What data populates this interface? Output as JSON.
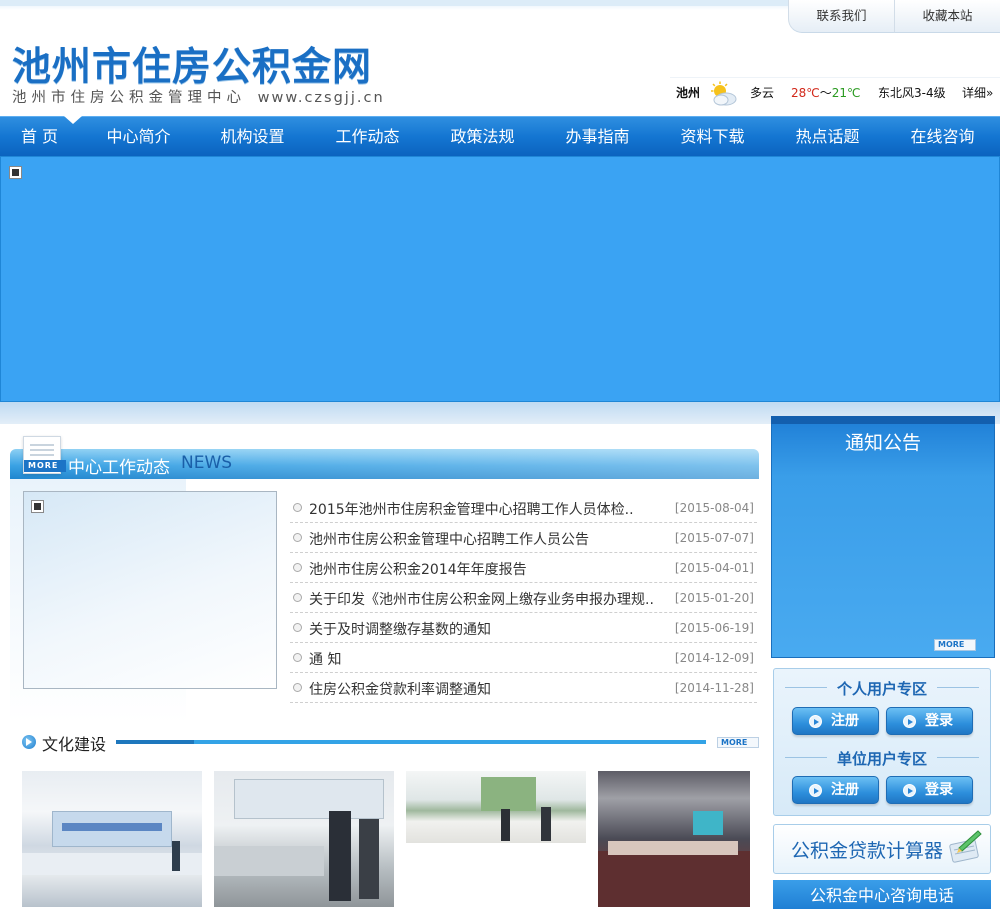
{
  "header": {
    "site_title": "池州市住房公积金网",
    "site_subtitle": "池州市住房公积金管理中心",
    "site_url": "www.czsgjj.cn",
    "top_links": {
      "contact": "联系我们",
      "favorite": "收藏本站"
    }
  },
  "weather": {
    "city": "池州",
    "condition": "多云",
    "temp_high": "28℃",
    "temp_sep": "～",
    "temp_low": "21℃",
    "wind": "东北风3-4级",
    "detail": "详细»",
    "icon": "partly-cloudy-icon"
  },
  "nav": {
    "items": [
      "首 页",
      "中心简介",
      "机构设置",
      "工作动态",
      "政策法规",
      "办事指南",
      "资料下载",
      "热点话题",
      "在线咨询"
    ]
  },
  "news": {
    "title": "中心工作动态",
    "title_en": "NEWS",
    "more": "MORE",
    "items": [
      {
        "title": "2015年池州市住房积金管理中心招聘工作人员体检..",
        "date": "[2015-08-04]"
      },
      {
        "title": "池州市住房公积金管理中心招聘工作人员公告",
        "date": "[2015-07-07]"
      },
      {
        "title": "池州市住房公积金2014年年度报告",
        "date": "[2015-04-01]"
      },
      {
        "title": "关于印发《池州市住房公积金网上缴存业务申报办理规..",
        "date": "[2015-01-20]"
      },
      {
        "title": "关于及时调整缴存基数的通知",
        "date": "[2015-06-19]"
      },
      {
        "title": "通  知",
        "date": "[2014-12-09]"
      },
      {
        "title": "住房公积金贷款利率调整通知",
        "date": "[2014-11-28]"
      }
    ]
  },
  "culture": {
    "title": "文化建设",
    "more": "MORE"
  },
  "sidebar": {
    "notice_title": "通知公告",
    "notice_more": "MORE",
    "personal_title": "个人用户专区",
    "unit_title": "单位用户专区",
    "register": "注册",
    "login": "登录",
    "calculator": "公积金贷款计算器",
    "hotline": "公积金中心咨询电话"
  },
  "colors": {
    "nav_blue": "#1476d2",
    "banner_blue": "#3aa3f3",
    "title_blue": "#1a6fc4",
    "temp_high": "#d2281a",
    "temp_low": "#2a9a20"
  }
}
